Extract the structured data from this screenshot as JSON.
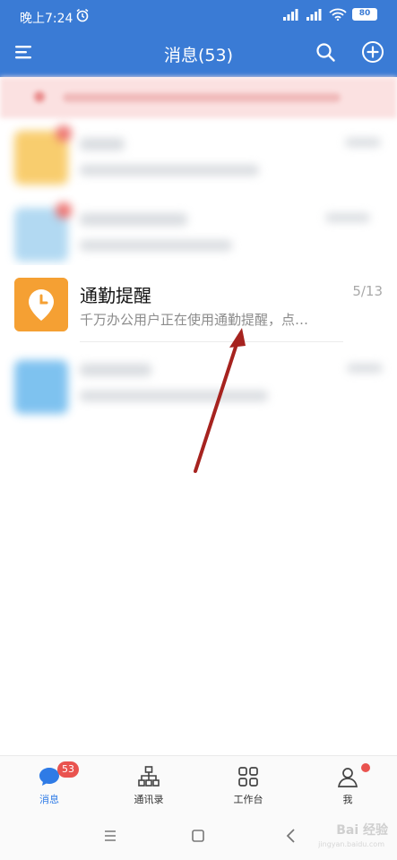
{
  "status": {
    "time": "晚上7:24",
    "battery": "80"
  },
  "header": {
    "title": "消息(53)"
  },
  "main_item": {
    "title": "通勤提醒",
    "date": "5/13",
    "preview": "千万办公用户正在使用通勤提醒，点…",
    "avatar_color": "#f5a033"
  },
  "tabs": [
    {
      "label": "消息",
      "badge": "53",
      "active": true
    },
    {
      "label": "通讯录"
    },
    {
      "label": "工作台"
    },
    {
      "label": "我"
    }
  ],
  "watermark": {
    "text": "Bai 经验",
    "sub": "jingyan.baidu.com"
  },
  "colors": {
    "header": "#3a7bd5",
    "accent": "#2f7be6",
    "badge": "#e9534f",
    "arrow": "#a6231f"
  }
}
